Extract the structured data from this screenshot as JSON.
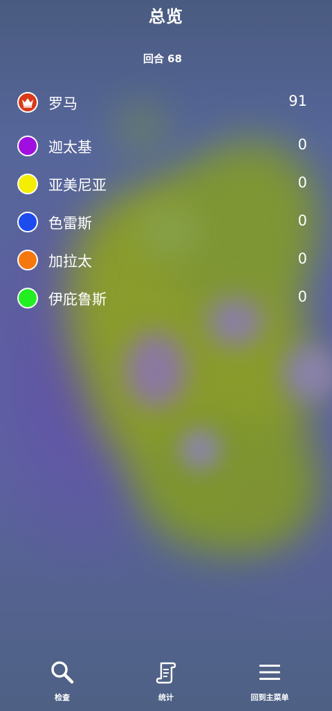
{
  "header": {
    "title": "总览",
    "turn_label": "回合 68"
  },
  "civilizations": [
    {
      "name": "罗马",
      "score": "91",
      "color": "#d83a1a",
      "icon": "crown-icon"
    },
    {
      "name": "迦太基",
      "score": "0",
      "color": "#a10ee0"
    },
    {
      "name": "亚美尼亚",
      "score": "0",
      "color": "#f5ee00"
    },
    {
      "name": "色雷斯",
      "score": "0",
      "color": "#1c4cf0"
    },
    {
      "name": "加拉太",
      "score": "0",
      "color": "#f5780f"
    },
    {
      "name": "伊庇鲁斯",
      "score": "0",
      "color": "#22ee22"
    }
  ],
  "bottom_nav": {
    "inspect": {
      "label": "检查",
      "icon": "search-icon"
    },
    "stats": {
      "label": "统计",
      "icon": "scroll-icon"
    },
    "main_menu": {
      "label": "回到主菜单",
      "icon": "menu-icon"
    }
  }
}
